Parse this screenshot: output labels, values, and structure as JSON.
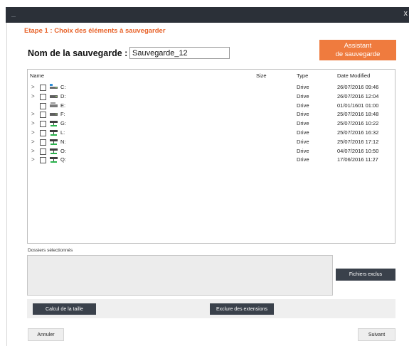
{
  "window": {
    "close_glyph": "x"
  },
  "step_title": "Etape 1 :   Choix des éléments à sauvegarder",
  "backup_name": {
    "label": "Nom de la sauvegarde :",
    "value": "Sauvegarde_12"
  },
  "assistant_button": {
    "line1": "Assistant",
    "line2": "de sauvegarde"
  },
  "file_list": {
    "columns": {
      "name": "Name",
      "size": "Size",
      "type": "Type",
      "date": "Date Modified"
    },
    "rows": [
      {
        "expander": ">",
        "name": "C:",
        "size": "",
        "type": "Drive",
        "date": "26/07/2016 09:46",
        "icon": "system-drive-icon"
      },
      {
        "expander": ">",
        "name": "D:",
        "size": "",
        "type": "Drive",
        "date": "26/07/2016 12:04",
        "icon": "drive-icon"
      },
      {
        "expander": "",
        "name": "E:",
        "size": "",
        "type": "Drive",
        "date": "01/01/1601 01:00",
        "icon": "optical-drive-icon"
      },
      {
        "expander": ">",
        "name": "F:",
        "size": "",
        "type": "Drive",
        "date": "25/07/2016 18:48",
        "icon": "drive-icon"
      },
      {
        "expander": ">",
        "name": "G:",
        "size": "",
        "type": "Drive",
        "date": "25/07/2016 10:22",
        "icon": "network-drive-icon"
      },
      {
        "expander": ">",
        "name": "L:",
        "size": "",
        "type": "Drive",
        "date": "25/07/2016 16:32",
        "icon": "network-drive-icon"
      },
      {
        "expander": ">",
        "name": "N:",
        "size": "",
        "type": "Drive",
        "date": "25/07/2016 17:12",
        "icon": "network-drive-icon"
      },
      {
        "expander": ">",
        "name": "O:",
        "size": "",
        "type": "Drive",
        "date": "04/07/2016 10:50",
        "icon": "network-drive-icon"
      },
      {
        "expander": ">",
        "name": "Q:",
        "size": "",
        "type": "Drive",
        "date": "17/06/2016 11:27",
        "icon": "network-drive-icon"
      }
    ]
  },
  "selected_folders": {
    "label": "Dossiers sélectionnés"
  },
  "buttons": {
    "excluded_files": "Fichiers exclus",
    "calculate_size": "Calcul de la taille",
    "exclude_extensions": "Exclure des extensions",
    "cancel": "Annuler",
    "next": "Suivant"
  },
  "colors": {
    "accent": "#ef7b3e",
    "step_title": "#e8632a",
    "dark_button": "#3a414b",
    "titlebar": "#2b3038"
  }
}
